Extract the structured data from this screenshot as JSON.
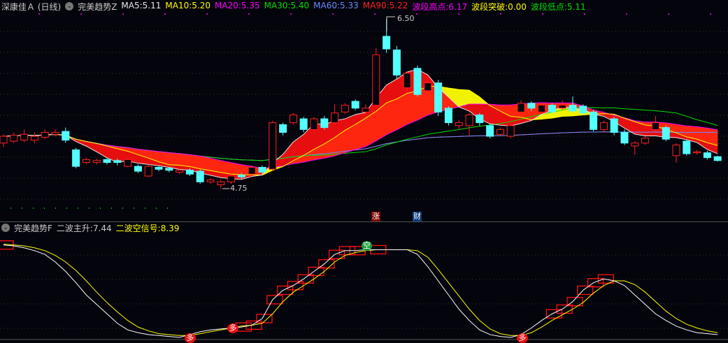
{
  "header": {
    "stock": "深康佳Ａ (日线)",
    "indicator": "完美趋势Z",
    "items": [
      {
        "label": "MA5: ",
        "value": "5.11",
        "color": "#e8e8e8"
      },
      {
        "label": "MA10: ",
        "value": "5.20",
        "color": "#ffff00"
      },
      {
        "label": "MA20: ",
        "value": "5.35",
        "color": "#ff00ff"
      },
      {
        "label": "MA30: ",
        "value": "5.40",
        "color": "#00e000"
      },
      {
        "label": "MA60: ",
        "value": "5.33",
        "color": "#6a8cff"
      },
      {
        "label": "MA90: ",
        "value": "5.22",
        "color": "#ff2020"
      },
      {
        "label": "波段高点: ",
        "value": "6.17",
        "color": "#ff00ff"
      },
      {
        "label": "波段突破: ",
        "value": "0.00",
        "color": "#ffff00"
      },
      {
        "label": "波段低点: ",
        "value": "5.11",
        "color": "#00e000"
      }
    ]
  },
  "lower_header": {
    "indicator": "完美趋势F",
    "main_label": "二波主升: ",
    "main_value": "7.44",
    "signal_label": "二波空信号: ",
    "signal_value": "8.39"
  },
  "annotations": {
    "high": "6.50",
    "low": "4.75",
    "zhang": "涨",
    "cai": "财",
    "kong": "空",
    "duo": "多"
  },
  "colors": {
    "up": "#ff2020",
    "down": "#54ffff",
    "fill_red": "#ff1010",
    "fill_yellow": "#ffff00"
  },
  "chart_data": {
    "type": "candlestick",
    "ylim": [
      4.6,
      6.7
    ],
    "candles": [
      [
        5.22,
        5.29,
        5.31,
        5.18
      ],
      [
        5.24,
        5.3,
        5.33,
        5.22
      ],
      [
        5.25,
        5.31,
        5.36,
        5.23
      ],
      [
        5.25,
        5.29,
        5.33,
        5.22
      ],
      [
        5.28,
        5.33,
        5.36,
        5.26
      ],
      [
        5.31,
        5.33,
        5.36,
        5.29
      ],
      [
        5.34,
        5.25,
        5.38,
        5.22
      ],
      [
        5.15,
        4.98,
        5.17,
        4.96
      ],
      [
        5.02,
        5.05,
        5.07,
        5.0
      ],
      [
        5.02,
        5.04,
        5.06,
        5.0
      ],
      [
        5.05,
        5.02,
        5.07,
        5.0
      ],
      [
        5.04,
        5.02,
        5.06,
        4.99
      ],
      [
        4.98,
        5.05,
        5.07,
        4.97
      ],
      [
        4.98,
        4.93,
        5.0,
        4.91
      ],
      [
        4.88,
        4.98,
        5.0,
        4.87
      ],
      [
        4.97,
        4.95,
        4.98,
        4.93
      ],
      [
        4.96,
        4.94,
        4.97,
        4.92
      ],
      [
        4.92,
        4.94,
        4.96,
        4.9
      ],
      [
        4.94,
        4.9,
        4.96,
        4.88
      ],
      [
        4.93,
        4.82,
        4.95,
        4.8
      ],
      [
        4.82,
        4.84,
        4.86,
        4.8
      ],
      [
        4.79,
        4.82,
        4.84,
        4.75
      ],
      [
        4.82,
        4.88,
        4.9,
        4.8
      ],
      [
        4.89,
        4.87,
        4.91,
        4.85
      ],
      [
        4.9,
        4.97,
        4.99,
        4.88
      ],
      [
        4.97,
        4.92,
        4.99,
        4.9
      ],
      [
        4.95,
        5.43,
        5.45,
        4.93
      ],
      [
        5.41,
        5.33,
        5.43,
        5.3
      ],
      [
        5.43,
        5.51,
        5.53,
        5.41
      ],
      [
        5.47,
        5.36,
        5.49,
        5.33
      ],
      [
        5.36,
        5.47,
        5.49,
        5.34
      ],
      [
        5.47,
        5.38,
        5.5,
        5.36
      ],
      [
        5.43,
        5.53,
        5.62,
        5.41
      ],
      [
        5.54,
        5.61,
        5.63,
        5.52
      ],
      [
        5.65,
        5.58,
        5.67,
        5.56
      ],
      [
        5.54,
        5.58,
        5.62,
        5.52
      ],
      [
        5.61,
        6.13,
        6.2,
        5.59
      ],
      [
        6.32,
        6.19,
        6.5,
        6.15
      ],
      [
        6.18,
        5.92,
        6.22,
        5.88
      ],
      [
        5.79,
        5.94,
        5.96,
        5.76
      ],
      [
        5.99,
        5.72,
        6.02,
        5.7
      ],
      [
        5.76,
        5.84,
        5.86,
        5.7
      ],
      [
        5.84,
        5.54,
        5.87,
        5.5
      ],
      [
        5.58,
        5.43,
        5.6,
        5.4
      ],
      [
        5.4,
        5.43,
        5.46,
        5.36
      ],
      [
        5.4,
        5.51,
        5.53,
        5.3
      ],
      [
        5.51,
        5.43,
        5.53,
        5.4
      ],
      [
        5.4,
        5.29,
        5.42,
        5.27
      ],
      [
        5.31,
        5.36,
        5.38,
        5.29
      ],
      [
        5.29,
        5.4,
        5.42,
        5.27
      ],
      [
        5.54,
        5.63,
        5.66,
        5.5
      ],
      [
        5.63,
        5.58,
        5.65,
        5.55
      ],
      [
        5.54,
        5.61,
        5.63,
        5.52
      ],
      [
        5.61,
        5.54,
        5.63,
        5.52
      ],
      [
        5.58,
        5.61,
        5.66,
        5.56
      ],
      [
        5.61,
        5.55,
        5.7,
        5.53
      ],
      [
        5.6,
        5.53,
        5.62,
        5.51
      ],
      [
        5.54,
        5.36,
        5.56,
        5.34
      ],
      [
        5.36,
        5.43,
        5.45,
        5.34
      ],
      [
        5.47,
        5.33,
        5.49,
        5.3
      ],
      [
        5.33,
        5.22,
        5.36,
        5.2
      ],
      [
        5.19,
        5.22,
        5.24,
        5.1
      ],
      [
        5.22,
        5.27,
        5.29,
        5.2
      ],
      [
        5.36,
        5.43,
        5.5,
        5.34
      ],
      [
        5.38,
        5.26,
        5.4,
        5.24
      ],
      [
        5.09,
        5.2,
        5.22,
        5.02
      ],
      [
        5.24,
        5.11,
        5.26,
        5.09
      ],
      [
        5.12,
        5.13,
        5.15,
        5.1
      ],
      [
        5.12,
        5.07,
        5.14,
        5.05
      ],
      [
        5.08,
        5.04,
        5.09,
        5.03
      ]
    ],
    "lower": {
      "ylim": [
        0,
        100
      ],
      "white": [
        98,
        97,
        95,
        92,
        88,
        80,
        70,
        58,
        45,
        35,
        25,
        15,
        8,
        5,
        3,
        2,
        1,
        0,
        3,
        6,
        8,
        9,
        10,
        11,
        13,
        20,
        40,
        50,
        55,
        62,
        70,
        78,
        88,
        92,
        92,
        93,
        93,
        93,
        93,
        93,
        88,
        75,
        60,
        45,
        30,
        18,
        8,
        3,
        1,
        0,
        3,
        10,
        18,
        25,
        30,
        38,
        50,
        58,
        62,
        60,
        55,
        45,
        35,
        25,
        18,
        12,
        8,
        5,
        4,
        3
      ],
      "yellow": [
        99,
        98,
        97,
        95,
        92,
        87,
        80,
        71,
        60,
        48,
        37,
        27,
        18,
        11,
        7,
        4,
        3,
        2,
        2,
        4,
        6,
        8,
        10,
        12,
        13,
        15,
        25,
        38,
        48,
        55,
        62,
        70,
        80,
        87,
        90,
        92,
        93,
        93,
        93,
        93,
        92,
        85,
        72,
        58,
        44,
        30,
        18,
        9,
        4,
        2,
        2,
        5,
        11,
        18,
        24,
        30,
        37,
        47,
        55,
        60,
        60,
        56,
        48,
        38,
        28,
        20,
        14,
        10,
        7,
        5
      ],
      "boxes": [
        0,
        23,
        24,
        25,
        26,
        27,
        28,
        29,
        30,
        31,
        32,
        33,
        34,
        36,
        53,
        54,
        55,
        56,
        57,
        58
      ]
    }
  }
}
